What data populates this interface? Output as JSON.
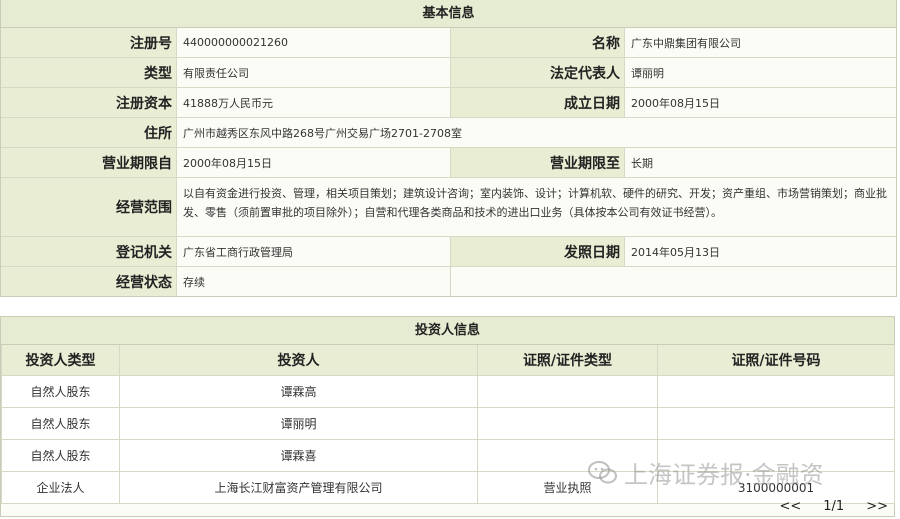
{
  "basic_info": {
    "header": "基本信息",
    "rows": [
      {
        "l1": "注册号",
        "v1": "440000000021260",
        "l2": "名称",
        "v2": "广东中鼎集团有限公司"
      },
      {
        "l1": "类型",
        "v1": "有限责任公司",
        "l2": "法定代表人",
        "v2": "谭丽明"
      },
      {
        "l1": "注册资本",
        "v1": "41888万人民币元",
        "l2": "成立日期",
        "v2": "2000年08月15日"
      }
    ],
    "address": {
      "label": "住所",
      "value": "广州市越秀区东风中路268号广州交易广场2701-2708室"
    },
    "period": {
      "l1": "营业期限自",
      "v1": "2000年08月15日",
      "l2": "营业期限至",
      "v2": "长期"
    },
    "scope": {
      "label": "经营范围",
      "value": "以自有资金进行投资、管理，相关项目策划；建筑设计咨询；室内装饰、设计；计算机软、硬件的研究、开发；资产重组、市场营销策划；商业批发、零售（须前置审批的项目除外）；自营和代理各类商品和技术的进出口业务（具体按本公司有效证书经营）。"
    },
    "authority": {
      "l1": "登记机关",
      "v1": "广东省工商行政管理局",
      "l2": "发照日期",
      "v2": "2014年05月13日"
    },
    "status": {
      "label": "经营状态",
      "value": "存续"
    }
  },
  "investors": {
    "header": "投资人信息",
    "columns": [
      "投资人类型",
      "投资人",
      "证照/证件类型",
      "证照/证件号码"
    ],
    "rows": [
      {
        "type": "自然人股东",
        "name": "谭霖高",
        "id_type": "",
        "id_no": ""
      },
      {
        "type": "自然人股东",
        "name": "谭丽明",
        "id_type": "",
        "id_no": ""
      },
      {
        "type": "自然人股东",
        "name": "谭霖喜",
        "id_type": "",
        "id_no": ""
      },
      {
        "type": "企业法人",
        "name": "上海长江财富资产管理有限公司",
        "id_type": "营业执照",
        "id_no": "3100000001"
      }
    ],
    "pager": {
      "prev": "<<",
      "page": "1/1",
      "next": ">>"
    }
  },
  "watermark": {
    "text": "上海证券报·金融资"
  }
}
